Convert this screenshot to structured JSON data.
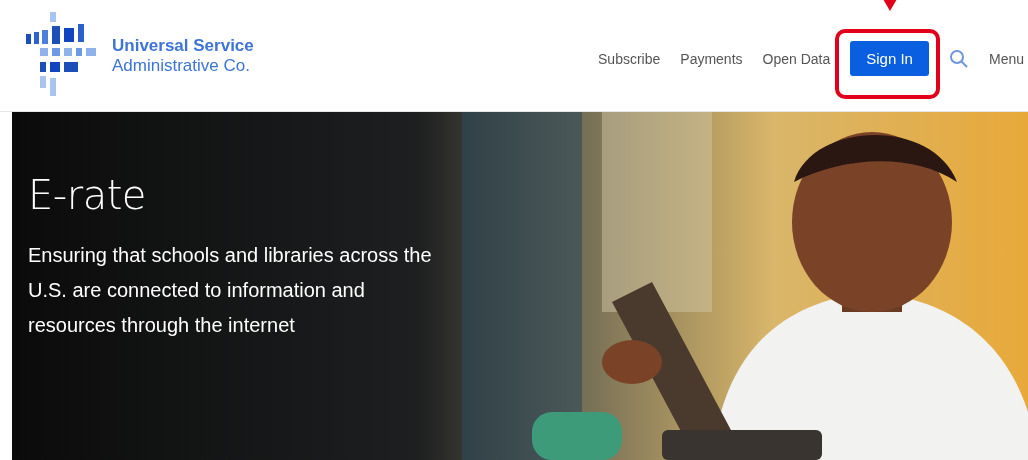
{
  "header": {
    "logo": {
      "line_1": "Universal Service",
      "line_2": "Administrative Co."
    },
    "nav": [
      {
        "kind": "link",
        "label": "Subscribe",
        "highlighted": false
      },
      {
        "kind": "link",
        "label": "Payments",
        "highlighted": false
      },
      {
        "kind": "link",
        "label": "Open Data",
        "highlighted": false
      },
      {
        "kind": "button",
        "label": "Sign In",
        "highlighted": true
      },
      {
        "kind": "search"
      },
      {
        "kind": "link",
        "label": "Menu",
        "highlighted": false
      }
    ]
  },
  "hero": {
    "title": "E-rate",
    "description": "Ensuring that schools and libraries across the U.S. are connected to information and resources through the internet"
  }
}
